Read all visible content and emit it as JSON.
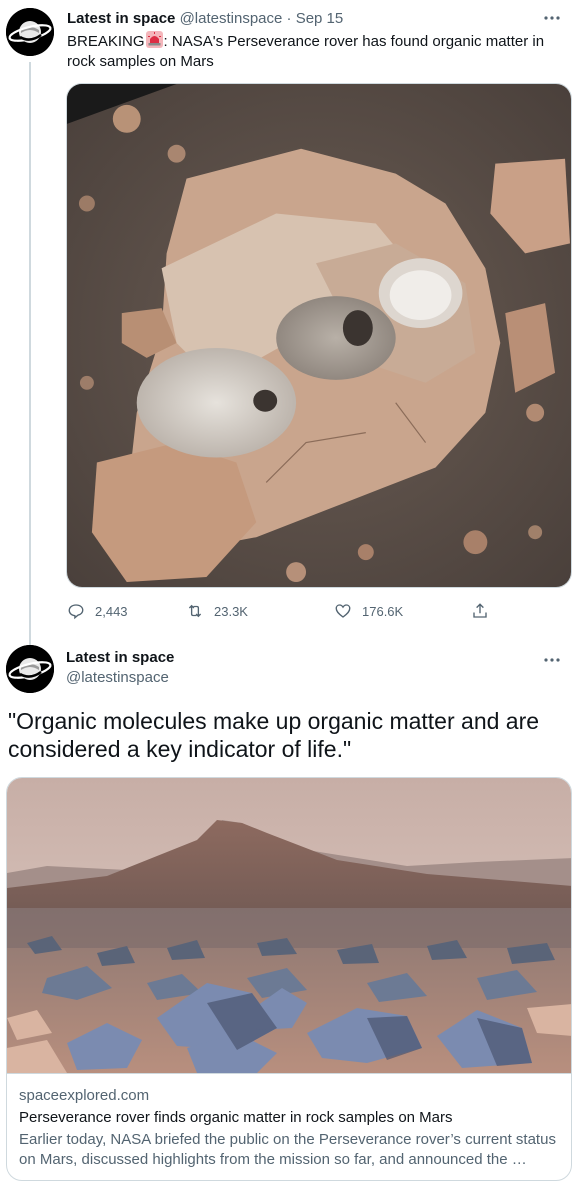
{
  "tweet1": {
    "name": "Latest in space",
    "handle": "@latestinspace",
    "separator": "·",
    "date": "Sep 15",
    "text_before": "BREAKING",
    "emoji_icon": "rotating-light-icon",
    "text_after": ": NASA's Perseverance rover has found organic matter in rock samples on Mars",
    "more_icon": "more-horizontal-icon",
    "image_icon": "mars-rock-samples-photo",
    "actions": {
      "replies": "2,443",
      "retweets": "23.3K",
      "likes": "176.6K"
    }
  },
  "tweet2": {
    "name": "Latest in space",
    "handle": "@latestinspace",
    "more_icon": "more-horizontal-icon",
    "text": "\"Organic molecules make up organic matter and are considered a key indicator of life.\"",
    "card": {
      "image_icon": "mars-landscape-photo",
      "domain": "spaceexplored.com",
      "title": "Perseverance rover finds organic matter in rock samples on Mars",
      "description": "Earlier today, NASA briefed the public on the Perseverance rover’s current status on Mars, discussed highlights from the mission so far, and announced the …"
    }
  },
  "colors": {
    "text_primary": "#0f1419",
    "text_secondary": "#536471",
    "border": "#cfd9de",
    "avatar_bg": "#000000"
  }
}
